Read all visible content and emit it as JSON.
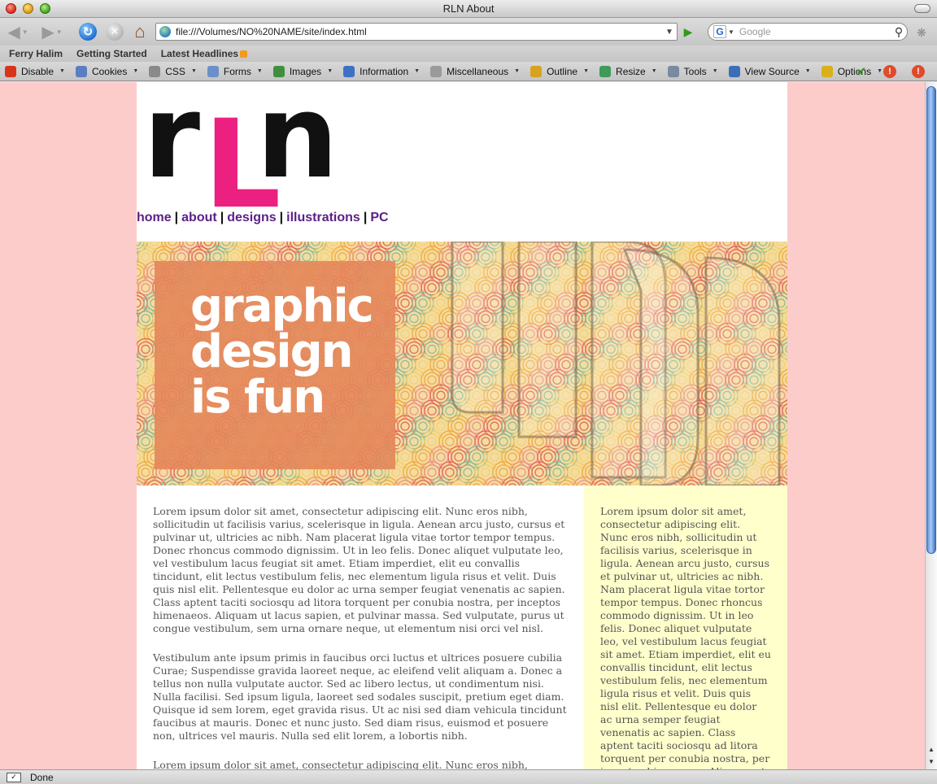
{
  "window": {
    "title": "RLN About"
  },
  "navigation": {
    "back_icon": "back-arrow-icon",
    "forward_icon": "forward-arrow-icon",
    "url": "file:///Volumes/NO%20NAME/site/index.html",
    "search_placeholder": "Google"
  },
  "bookmarks": [
    "Ferry Halim",
    "Getting Started",
    "Latest Headlines"
  ],
  "devtoolbar": {
    "items": [
      {
        "label": "Disable",
        "icon": "disable-icon",
        "color": "#d9331c"
      },
      {
        "label": "Cookies",
        "icon": "cookies-icon",
        "color": "#5a7fc0"
      },
      {
        "label": "CSS",
        "icon": "css-icon",
        "color": "#8a8a8a"
      },
      {
        "label": "Forms",
        "icon": "forms-icon",
        "color": "#6b8fc9"
      },
      {
        "label": "Images",
        "icon": "images-icon",
        "color": "#3f8f3f"
      },
      {
        "label": "Information",
        "icon": "information-icon",
        "color": "#3e70c6"
      },
      {
        "label": "Miscellaneous",
        "icon": "miscellaneous-icon",
        "color": "#9a9a9a"
      },
      {
        "label": "Outline",
        "icon": "outline-icon",
        "color": "#d9a21c"
      },
      {
        "label": "Resize",
        "icon": "resize-icon",
        "color": "#3d9a5a"
      },
      {
        "label": "Tools",
        "icon": "tools-icon",
        "color": "#7a8aa0"
      },
      {
        "label": "View Source",
        "icon": "view-source-icon",
        "color": "#3a6fb8"
      },
      {
        "label": "Options",
        "icon": "options-icon",
        "color": "#d9b01c"
      }
    ]
  },
  "site": {
    "logo_letters": [
      "r",
      "L",
      "n"
    ],
    "nav": [
      "home",
      "about",
      "designs",
      "illustrations",
      "PC"
    ],
    "banner_lines": [
      "graphic",
      "design",
      "is fun"
    ],
    "main_paragraphs": [
      "Lorem ipsum dolor sit amet, consectetur adipiscing elit. Nunc eros nibh, sollicitudin ut facilisis varius, scelerisque in ligula. Aenean arcu justo, cursus et pulvinar ut, ultricies ac nibh. Nam placerat ligula vitae tortor tempor tempus. Donec rhoncus commodo dignissim. Ut in leo felis. Donec aliquet vulputate leo, vel vestibulum lacus feugiat sit amet. Etiam imperdiet, elit eu convallis tincidunt, elit lectus vestibulum felis, nec elementum ligula risus et velit. Duis quis nisl elit. Pellentesque eu dolor ac urna semper feugiat venenatis ac sapien. Class aptent taciti sociosqu ad litora torquent per conubia nostra, per inceptos himenaeos. Aliquam ut lacus sapien, et pulvinar massa. Sed vulputate, purus ut congue vestibulum, sem urna ornare neque, ut elementum nisi orci vel nisl.",
      "Vestibulum ante ipsum primis in faucibus orci luctus et ultrices posuere cubilia Curae; Suspendisse gravida laoreet neque, ac eleifend velit aliquam a. Donec a tellus non nulla vulputate auctor. Sed ac libero lectus, ut condimentum nisi. Nulla facilisi. Sed ipsum ligula, laoreet sed sodales suscipit, pretium eget diam. Quisque id sem lorem, eget gravida risus. Ut ac nisi sed diam vehicula tincidunt faucibus at mauris. Donec et nunc justo. Sed diam risus, euismod et posuere non, ultrices vel mauris. Nulla sed elit lorem, a lobortis nibh.",
      "Lorem ipsum dolor sit amet, consectetur adipiscing elit. Nunc eros nibh,"
    ],
    "sidebar_text": "Lorem ipsum dolor sit amet, consectetur adipiscing elit. Nunc eros nibh, sollicitudin ut facilisis varius, scelerisque in ligula. Aenean arcu justo, cursus et pulvinar ut, ultricies ac nibh. Nam placerat ligula vitae tortor tempor tempus. Donec rhoncus commodo dignissim. Ut in leo felis. Donec aliquet vulputate leo, vel vestibulum lacus feugiat sit amet. Etiam imperdiet, elit eu convallis tincidunt, elit lectus vestibulum felis, nec elementum ligula risus et velit. Duis quis nisl elit. Pellentesque eu dolor ac urna semper feugiat venenatis ac sapien. Class aptent taciti sociosqu ad litora torquent per conubia nostra, per inceptos himenaeos. Aliquam ut lacus"
  },
  "status": {
    "text": "Done"
  },
  "colors": {
    "page_background": "#fccccb",
    "logo_black": "#111111",
    "logo_pink": "#ec2080",
    "nav_link": "#5b1f86",
    "sidebar_background": "#ffffcc",
    "banner_box": "#e4865a"
  }
}
